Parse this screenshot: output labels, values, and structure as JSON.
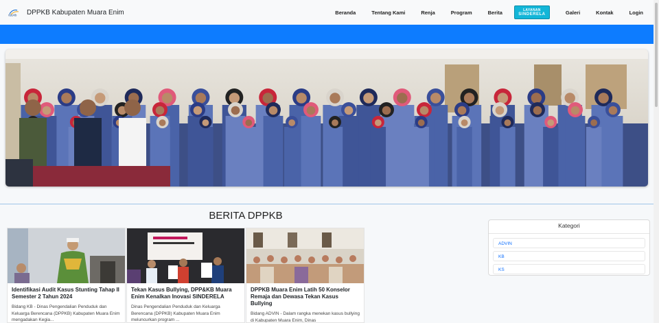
{
  "navbar": {
    "brand_logo_text": "dppkb",
    "brand_title": "DPPKB Kabupaten Muara Enim",
    "links": [
      "Beranda",
      "Tentang Kami",
      "Renja",
      "Program",
      "Berita"
    ],
    "badge_line1": "LAYANAN",
    "badge_line2": "SINDERELA",
    "links_after": [
      "Galeri",
      "Kontak",
      "Login"
    ]
  },
  "colors": {
    "blue_bar": "#0d7cff",
    "badge": "#13b6d8",
    "link": "#0d6efd"
  },
  "news": {
    "title": "BERITA DPPKB",
    "cards": [
      {
        "title": "Identifikasi Audit Kasus Stunting Tahap II Semester 2 Tahun 2024",
        "excerpt": "Bidang KB - Dinas Pengendalian Penduduk dan Keluarga Berencana (DPPKB) Kabupaten Muara Enim mengadakan Kegia..."
      },
      {
        "title": "Tekan Kasus Bullying, DPP&KB Muara Enim Kenalkan Inovasi SINDERELA",
        "excerpt": "Dinas Pengendalian Penduduk dan Keluarga Berencana (DPPKB) Kabupaten Muara Enim meluncurkan program ..."
      },
      {
        "title": "DPPKB Muara Enim Latih 50 Konselor Remaja dan Dewasa Tekan Kasus Bullying",
        "excerpt": "Bidang ADVIN - Dalam rangka menekan kasus bullying di Kabupaten Muara Enim, Dinas"
      }
    ]
  },
  "sidebar": {
    "title": "Kategori",
    "categories": [
      "ADVIN",
      "KB",
      "KS"
    ]
  }
}
